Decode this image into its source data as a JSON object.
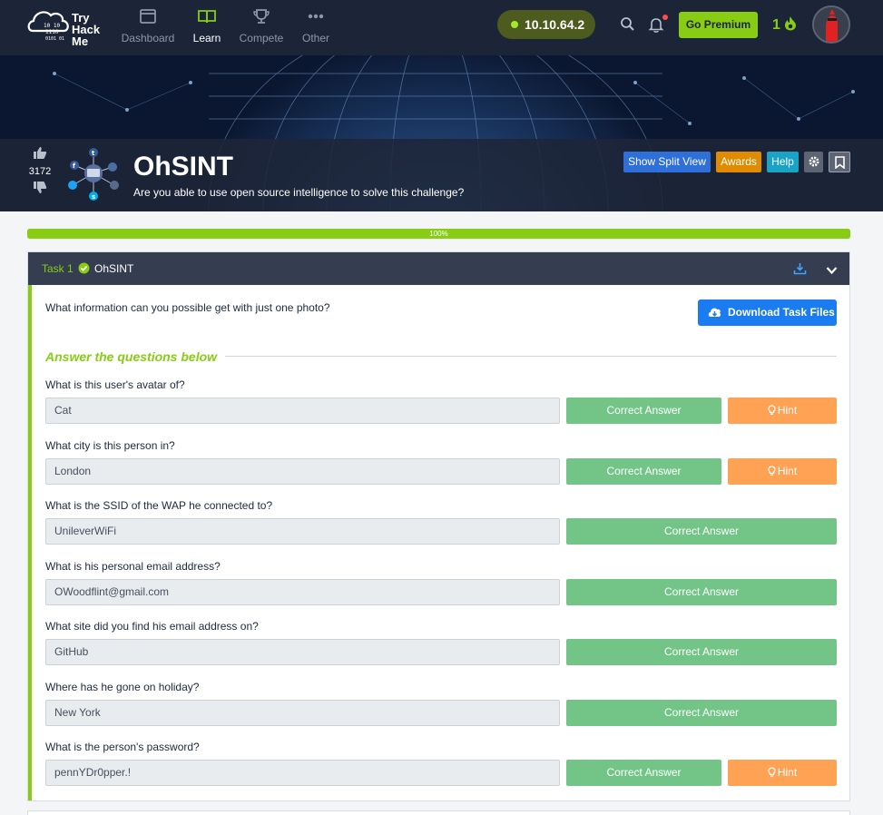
{
  "nav": {
    "logo_lines": [
      "Try",
      "Hack",
      "Me"
    ],
    "items": [
      {
        "label": "Dashboard",
        "icon": "dashboard-icon",
        "active": false
      },
      {
        "label": "Learn",
        "icon": "book-icon",
        "active": true
      },
      {
        "label": "Compete",
        "icon": "trophy-icon",
        "active": false
      },
      {
        "label": "Other",
        "icon": "more-icon",
        "active": false
      }
    ],
    "ip": "10.10.64.2",
    "premium_label": "Go Premium",
    "streak": "1"
  },
  "room": {
    "title": "OhSINT",
    "description": "Are you able to use open source intelligence to solve this challenge?",
    "votes": "3172",
    "buttons": {
      "split_view": "Show Split View",
      "awards": "Awards",
      "help": "Help"
    }
  },
  "progress": {
    "percent": 100,
    "label": "100%"
  },
  "task": {
    "number": "Task 1",
    "name": "OhSINT",
    "description": "What information can you possible get with just one photo?",
    "download_label": "Download Task Files",
    "answer_heading": "Answer the questions below",
    "questions": [
      {
        "question": "What is this user's avatar of?",
        "answer": "Cat",
        "correct_label": "Correct Answer",
        "hint_label": "Hint"
      },
      {
        "question": "What city is this person in?",
        "answer": "London",
        "correct_label": "Correct Answer",
        "hint_label": "Hint"
      },
      {
        "question": "What is the SSID of the WAP he connected to?",
        "answer": "UnileverWiFi",
        "correct_label": "Correct Answer"
      },
      {
        "question": "What is his personal email address?",
        "answer": "OWoodflint@gmail.com",
        "correct_label": "Correct Answer"
      },
      {
        "question": "What site did you find his email address on?",
        "answer": "GitHub",
        "correct_label": "Correct Answer"
      },
      {
        "question": "Where has he gone on holiday?",
        "answer": "New York",
        "correct_label": "Correct Answer"
      },
      {
        "question": "What is the person's password?",
        "answer": "pennYDr0pper.!",
        "correct_label": "Correct Answer",
        "hint_label": "Hint"
      }
    ]
  },
  "colors": {
    "nav_bg": "#1c2538",
    "accent_green": "#88cc14",
    "correct_green": "#72c586",
    "hint_orange": "#ffa254",
    "download_blue": "#1a7cf0"
  }
}
